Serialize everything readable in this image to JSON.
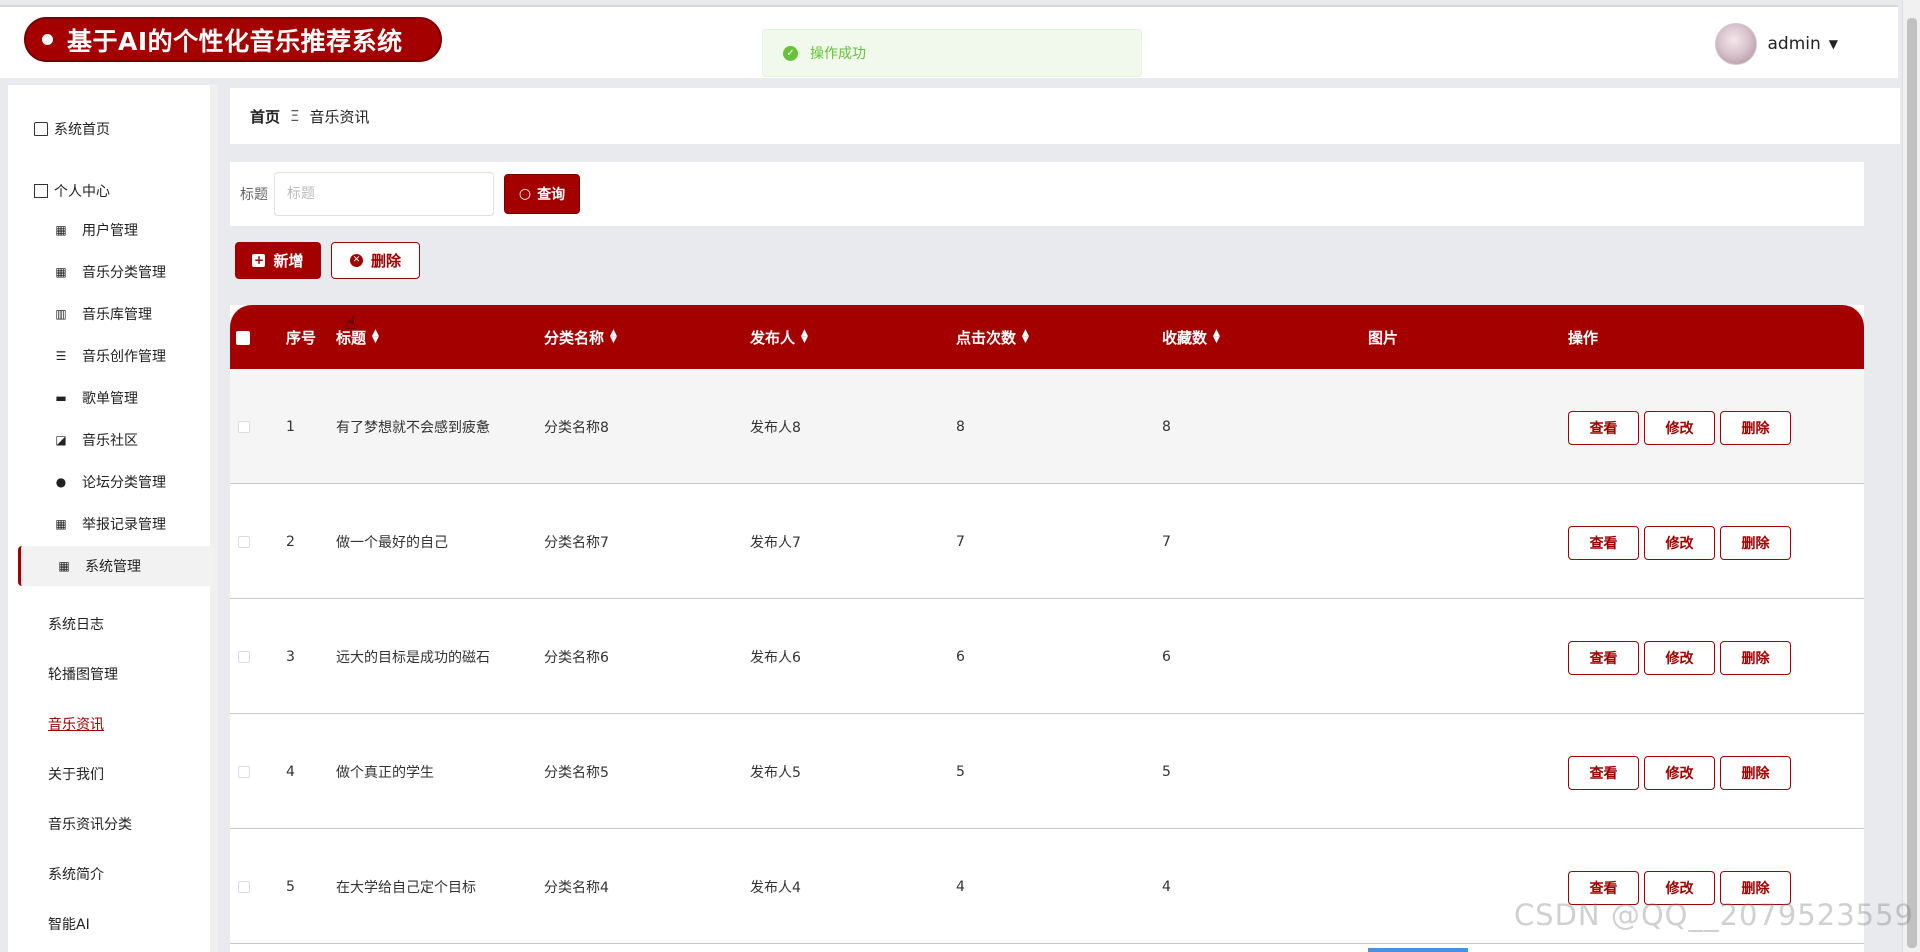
{
  "brand": {
    "title": "基于AI的个性化音乐推荐系统"
  },
  "toast": {
    "text": "操作成功"
  },
  "user": {
    "name": "admin"
  },
  "sidebar": {
    "home": "系统首页",
    "personal": "个人中心",
    "items": [
      {
        "label": "用户管理",
        "icon": "grid-icon"
      },
      {
        "label": "音乐分类管理",
        "icon": "grid-icon"
      },
      {
        "label": "音乐库管理",
        "icon": "library-icon"
      },
      {
        "label": "音乐创作管理",
        "icon": "list-icon"
      },
      {
        "label": "歌单管理",
        "icon": "chat-icon"
      },
      {
        "label": "音乐社区",
        "icon": "chart-icon"
      },
      {
        "label": "论坛分类管理",
        "icon": "user-icon"
      },
      {
        "label": "举报记录管理",
        "icon": "grid-icon"
      },
      {
        "label": "系统管理",
        "icon": "grid-icon"
      }
    ],
    "sub_items": [
      "系统日志",
      "轮播图管理",
      "音乐资讯",
      "关于我们",
      "音乐资讯分类",
      "系统简介",
      "智能AI"
    ]
  },
  "breadcrumb": {
    "home": "首页",
    "separator": "Ξ",
    "current": "音乐资讯"
  },
  "search": {
    "label": "标题",
    "placeholder": "标题",
    "button": "查询"
  },
  "toolbar": {
    "add": "新增",
    "delete": "删除"
  },
  "table": {
    "headers": [
      "序号",
      "标题",
      "分类名称",
      "发布人",
      "点击次数",
      "收藏数",
      "图片",
      "操作"
    ],
    "rows": [
      {
        "no": "1",
        "title": "有了梦想就不会感到疲惫",
        "category": "分类名称8",
        "publisher": "发布人8",
        "clicks": "8",
        "favorites": "8"
      },
      {
        "no": "2",
        "title": "做一个最好的自己",
        "category": "分类名称7",
        "publisher": "发布人7",
        "clicks": "7",
        "favorites": "7"
      },
      {
        "no": "3",
        "title": "远大的目标是成功的磁石",
        "category": "分类名称6",
        "publisher": "发布人6",
        "clicks": "6",
        "favorites": "6"
      },
      {
        "no": "4",
        "title": "做个真正的学生",
        "category": "分类名称5",
        "publisher": "发布人5",
        "clicks": "5",
        "favorites": "5"
      },
      {
        "no": "5",
        "title": "在大学给自己定个目标",
        "category": "分类名称4",
        "publisher": "发布人4",
        "clicks": "4",
        "favorites": "4"
      }
    ],
    "actions": {
      "view": "查看",
      "edit": "修改",
      "delete": "删除"
    }
  },
  "watermark": "CSDN @QQ__2079523559",
  "colors": {
    "accent": "#a40000",
    "success": "#67c23a"
  }
}
